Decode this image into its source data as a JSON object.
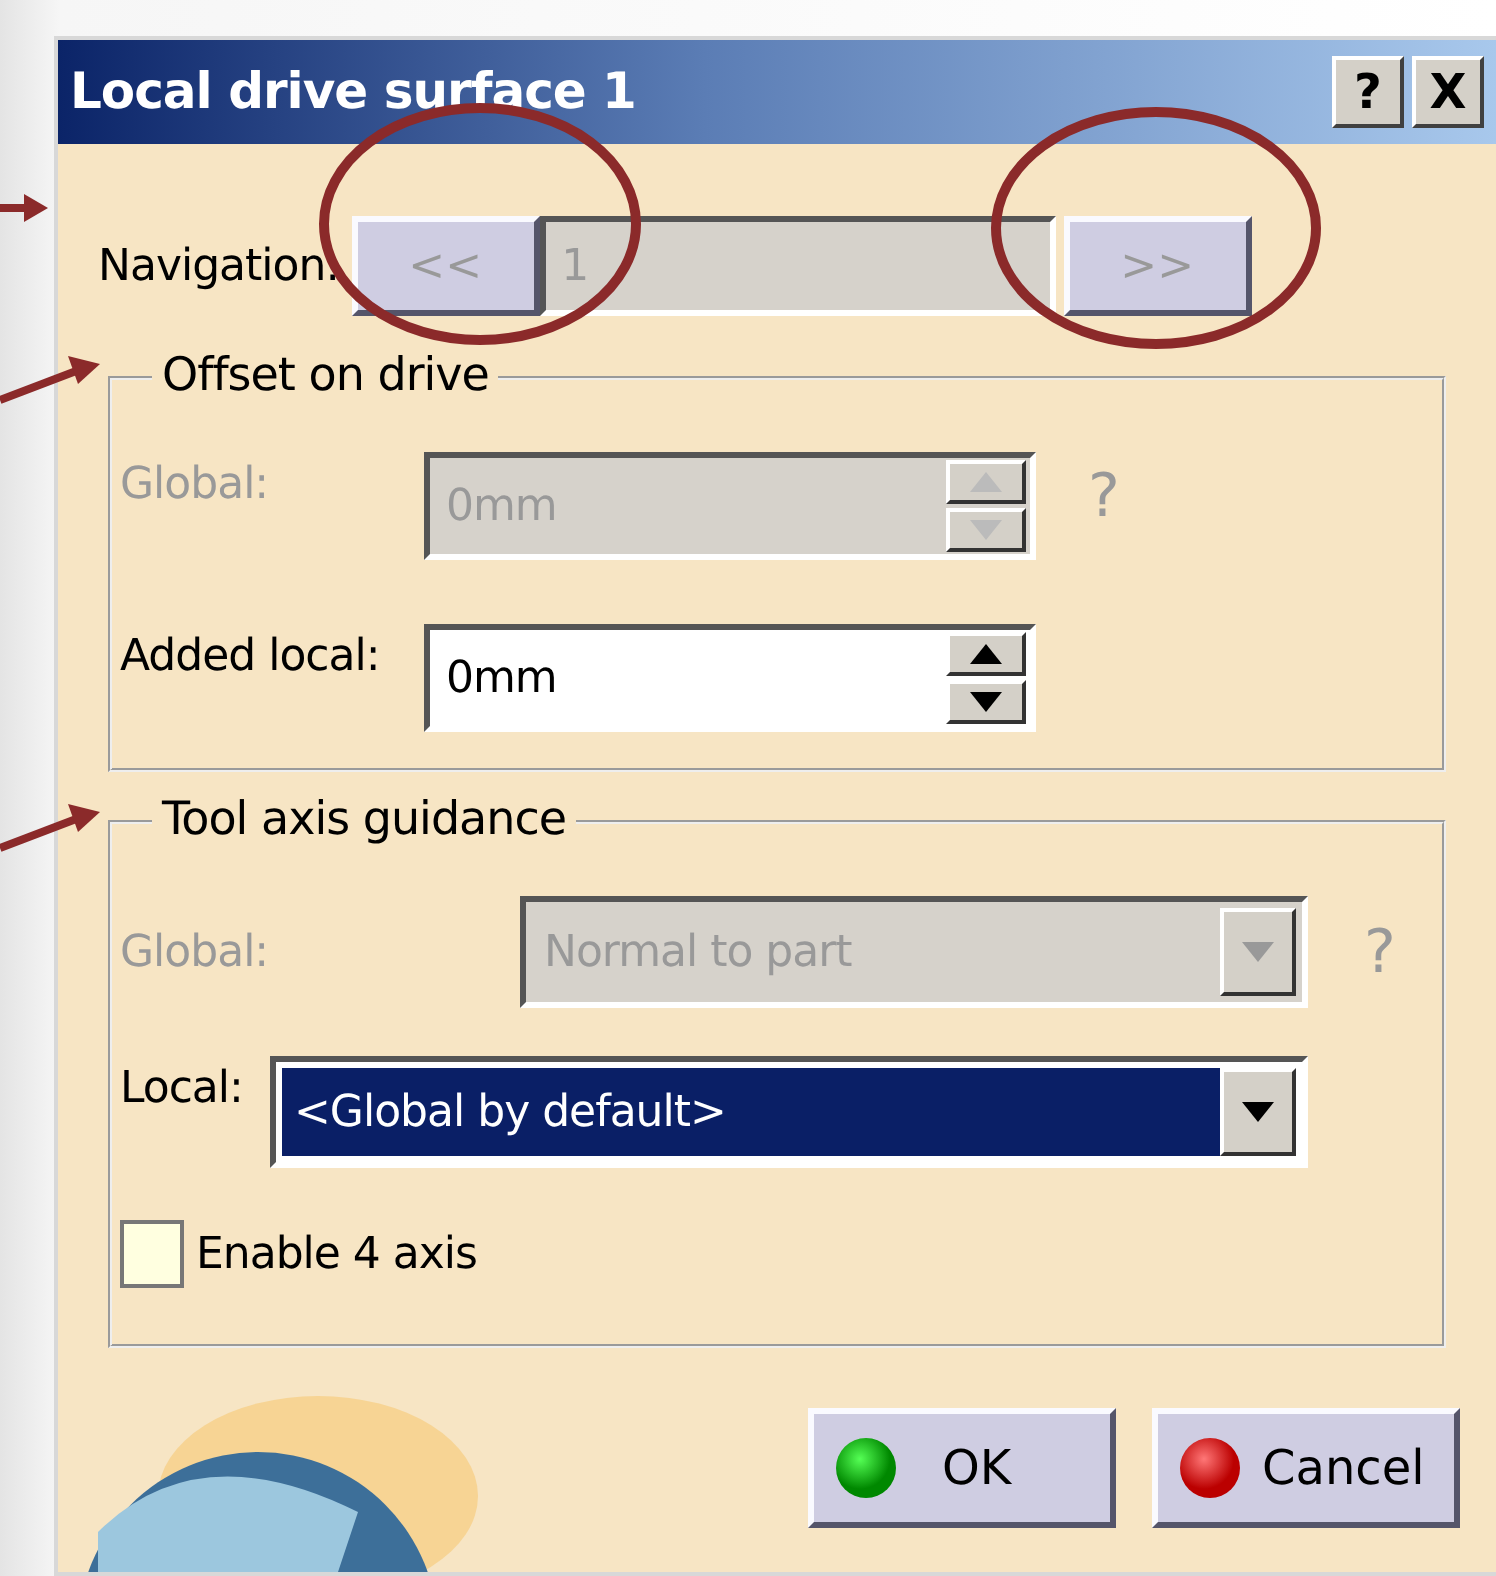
{
  "window": {
    "title": "Local drive surface 1",
    "help_button": "?",
    "close_button": "X"
  },
  "navigation": {
    "label": "Navigation:",
    "previous": "<<",
    "value": "1",
    "next": ">>",
    "disabled": true
  },
  "offset_on_drive": {
    "title": "Offset on drive",
    "global": {
      "label": "Global:",
      "value": "0mm",
      "disabled": true,
      "help": "?"
    },
    "added_local": {
      "label": "Added local:",
      "value": "0mm",
      "disabled": false
    }
  },
  "tool_axis_guidance": {
    "title": "Tool axis guidance",
    "global": {
      "label": "Global:",
      "value": "Normal to part",
      "disabled": true,
      "help": "?"
    },
    "local": {
      "label": "Local:",
      "value": "<Global by default>",
      "selected": true
    },
    "enable_4_axis": {
      "label": "Enable 4 axis",
      "checked": false
    }
  },
  "buttons": [
    {
      "label": "OK",
      "kind": "ok"
    },
    {
      "label": "Cancel",
      "kind": "cancel"
    }
  ]
}
